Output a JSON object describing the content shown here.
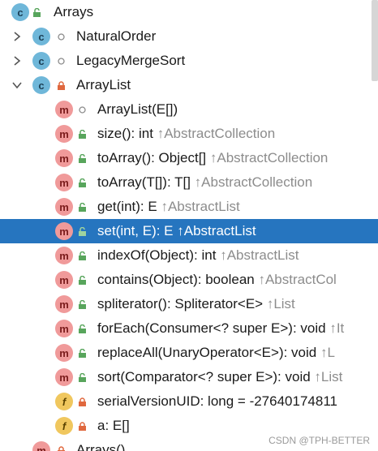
{
  "tree": {
    "rows": [
      {
        "label": "Arrays",
        "inherited": ""
      },
      {
        "label": "NaturalOrder",
        "inherited": ""
      },
      {
        "label": "LegacyMergeSort",
        "inherited": ""
      },
      {
        "label": "ArrayList",
        "inherited": ""
      },
      {
        "label": "ArrayList(E[])",
        "inherited": ""
      },
      {
        "label": "size(): int",
        "inherited": "↑AbstractCollection"
      },
      {
        "label": "toArray(): Object[]",
        "inherited": "↑AbstractCollection"
      },
      {
        "label": "toArray(T[]): T[]",
        "inherited": "↑AbstractCollection"
      },
      {
        "label": "get(int): E",
        "inherited": "↑AbstractList"
      },
      {
        "label": "set(int, E): E",
        "inherited": "↑AbstractList"
      },
      {
        "label": "indexOf(Object): int",
        "inherited": "↑AbstractList"
      },
      {
        "label": "contains(Object): boolean",
        "inherited": "↑AbstractCol"
      },
      {
        "label": "spliterator(): Spliterator<E>",
        "inherited": "↑List"
      },
      {
        "label": "forEach(Consumer<? super E>): void",
        "inherited": "↑It"
      },
      {
        "label": "replaceAll(UnaryOperator<E>): void",
        "inherited": "↑L"
      },
      {
        "label": "sort(Comparator<? super E>): void",
        "inherited": "↑List"
      },
      {
        "label": "serialVersionUID: long = -27640174811",
        "inherited": ""
      },
      {
        "label": "a: E[]",
        "inherited": ""
      },
      {
        "label": "Arrays()",
        "inherited": ""
      }
    ],
    "badges": {
      "class": "c",
      "method": "m",
      "field": "f"
    }
  },
  "watermark": "CSDN @TPH-BETTER",
  "colors": {
    "selection": "#2675bf",
    "muted": "#8c8c8c"
  }
}
